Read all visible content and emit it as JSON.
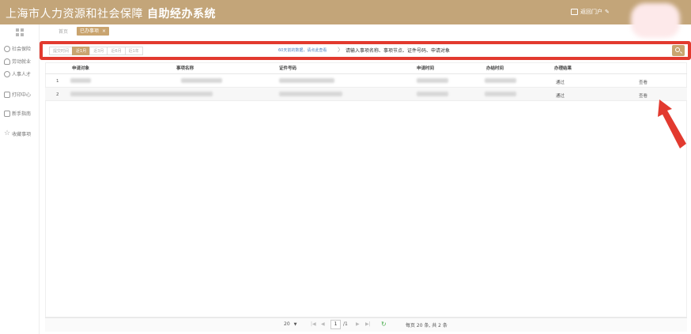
{
  "header": {
    "title_prefix": "上海市人力资源和社会保障",
    "title_bold": "自助经办系统",
    "portal_link": "返回门户"
  },
  "sidebar": {
    "items": [
      {
        "label": "社会保险",
        "icon": "shield-icon"
      },
      {
        "label": "劳动就业",
        "icon": "person-icon"
      },
      {
        "label": "人事人才",
        "icon": "users-icon"
      },
      {
        "label": "打印中心",
        "icon": "printer-icon"
      },
      {
        "label": "新手指南",
        "icon": "book-icon"
      },
      {
        "label": "收藏事项",
        "icon": "star-icon"
      }
    ]
  },
  "tabs": {
    "home": "首页",
    "active": "已办事项",
    "close": "×"
  },
  "search": {
    "filters": [
      "提交时间",
      "近1月",
      "近3月",
      "近6月",
      "近1年"
    ],
    "active_filter": 1,
    "hint": "60天前的数据，请点此查看",
    "chevron": "〉",
    "placeholder": "请输入事项名称、事项节点、证件号码、申请对象"
  },
  "table": {
    "columns": [
      "申请对象",
      "事项名称",
      "证件号码",
      "申请时间",
      "办结时间",
      "办理结果"
    ],
    "rows": [
      {
        "index": "1",
        "result": "通过",
        "action": "查看"
      },
      {
        "index": "2",
        "result": "通过",
        "action": "查看"
      }
    ]
  },
  "pager": {
    "page_size": "20",
    "page_size_caret": "▼",
    "first": "|◀",
    "prev": "◀",
    "current": "1",
    "of": "/1",
    "next": "▶",
    "last": "▶|",
    "refresh": "↻",
    "summary": "每页 20 条, 共 2 条"
  },
  "colors": {
    "header_bg": "#c3a579",
    "accent": "#c9a46f",
    "highlight_red": "#e23a2f"
  }
}
